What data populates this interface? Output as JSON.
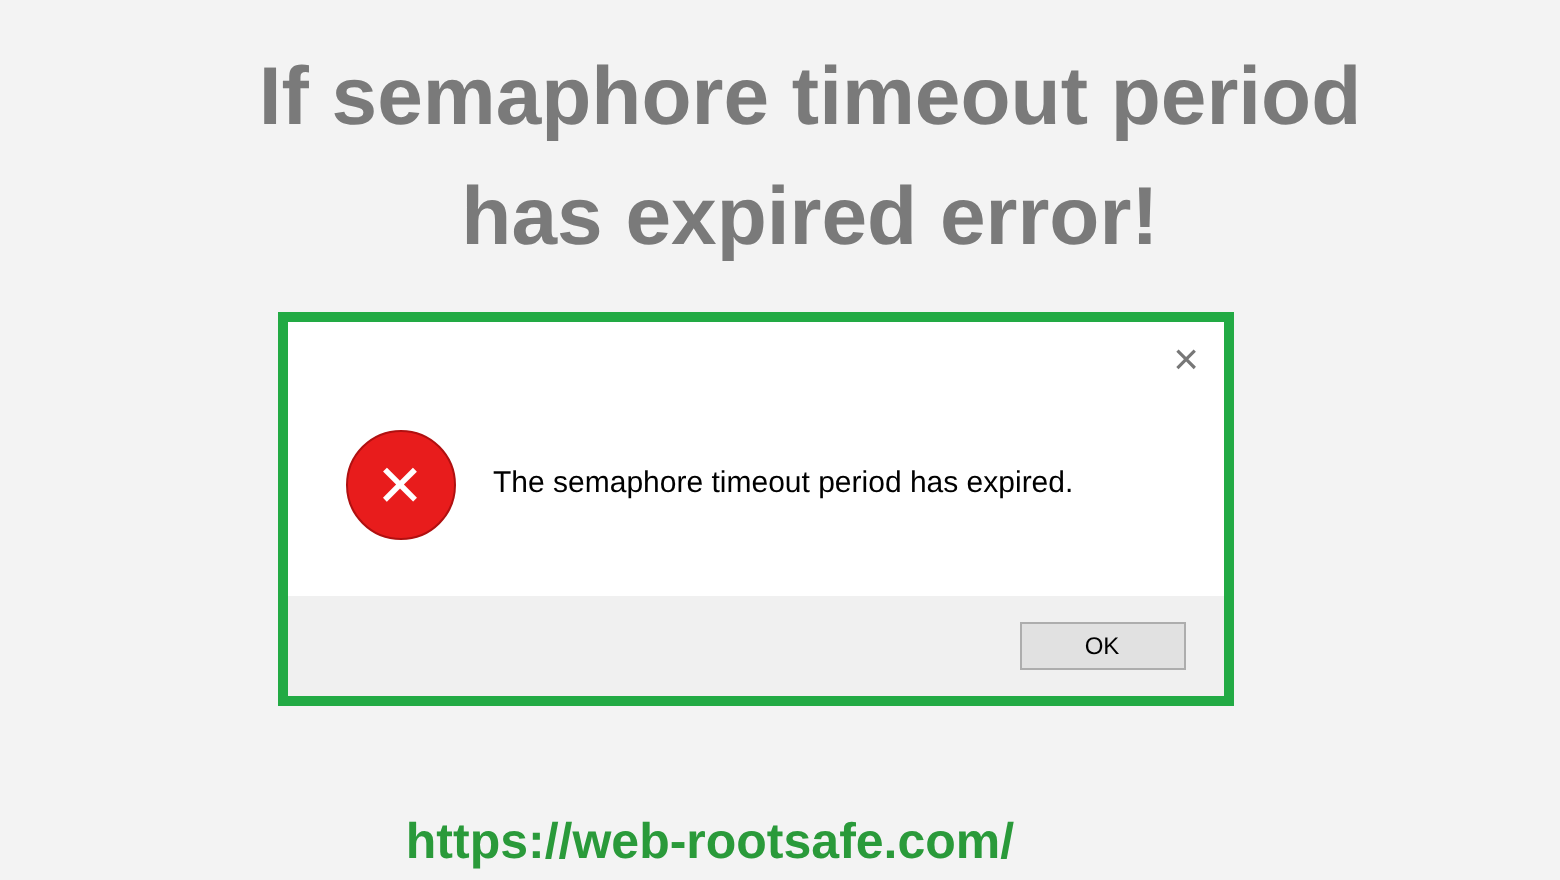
{
  "headline": {
    "lines": [
      "If semaphore timeout period",
      "has expired error!"
    ]
  },
  "dialog": {
    "close": "×",
    "icon": "×",
    "message": "The semaphore timeout period has expired.",
    "buttons": [
      "OK"
    ]
  },
  "caption": "https://web-rootsafe.com/"
}
